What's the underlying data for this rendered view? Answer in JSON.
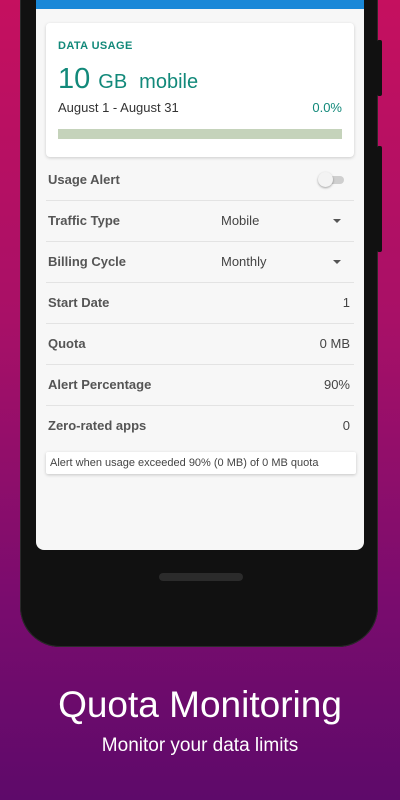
{
  "usage": {
    "title": "DATA USAGE",
    "amount": "10",
    "unit": "GB",
    "kind": "mobile",
    "period": "August 1 - August 31",
    "percent": "0.0%",
    "progress": 0.0
  },
  "settings": {
    "usage_alert": {
      "label": "Usage Alert",
      "enabled": false
    },
    "traffic_type": {
      "label": "Traffic Type",
      "value": "Mobile"
    },
    "billing_cycle": {
      "label": "Billing Cycle",
      "value": "Monthly"
    },
    "start_date": {
      "label": "Start Date",
      "value": "1"
    },
    "quota": {
      "label": "Quota",
      "value": "0 MB"
    },
    "alert_percentage": {
      "label": "Alert Percentage",
      "value": "90%"
    },
    "zero_rated_apps": {
      "label": "Zero-rated apps",
      "value": "0"
    }
  },
  "alert_note": "Alert when usage exceeded 90% (0 MB) of 0 MB quota",
  "caption": {
    "headline": "Quota Monitoring",
    "subline": "Monitor your data limits"
  },
  "colors": {
    "accent": "#12897a",
    "appbar": "#1a88d8",
    "progress_track": "#c5d3bb"
  }
}
